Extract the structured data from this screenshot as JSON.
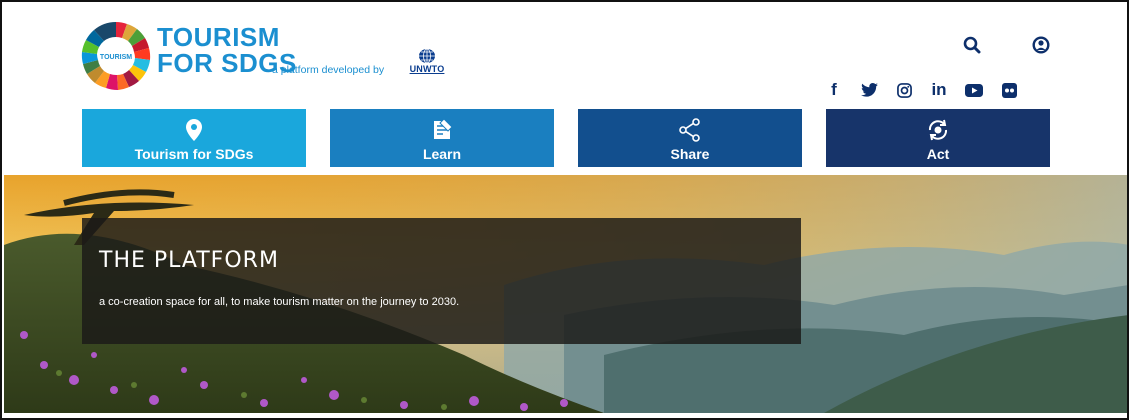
{
  "header": {
    "logo": {
      "wheel_text": "TOURISM",
      "title_line1": "TOURISM",
      "title_line2": "FOR SDGS",
      "subtitle": "a platform developed by",
      "partner": "UNWTO"
    },
    "icons": {
      "search": "search-icon",
      "account": "user-account-icon"
    },
    "social": [
      "facebook-icon",
      "twitter-icon",
      "instagram-icon",
      "linkedin-icon",
      "youtube-icon",
      "flickr-icon"
    ],
    "social_labels": {
      "facebook": "f",
      "linkedin": "in"
    }
  },
  "nav": {
    "tabs": [
      {
        "label": "Tourism for SDGs",
        "icon": "map-pin-icon",
        "color": "#1aa7dc"
      },
      {
        "label": "Learn",
        "icon": "book-icon",
        "color": "#1a7fc0"
      },
      {
        "label": "Share",
        "icon": "share-icon",
        "color": "#124f8e"
      },
      {
        "label": "Act",
        "icon": "act-cycle-icon",
        "color": "#17346a"
      }
    ]
  },
  "hero": {
    "title": "THE PLATFORM",
    "subtitle": "a co-creation space for all, to make tourism matter on the journey to 2030."
  },
  "colors": {
    "brand_blue": "#1b8fd0",
    "dark_navy": "#0d2f6b"
  }
}
